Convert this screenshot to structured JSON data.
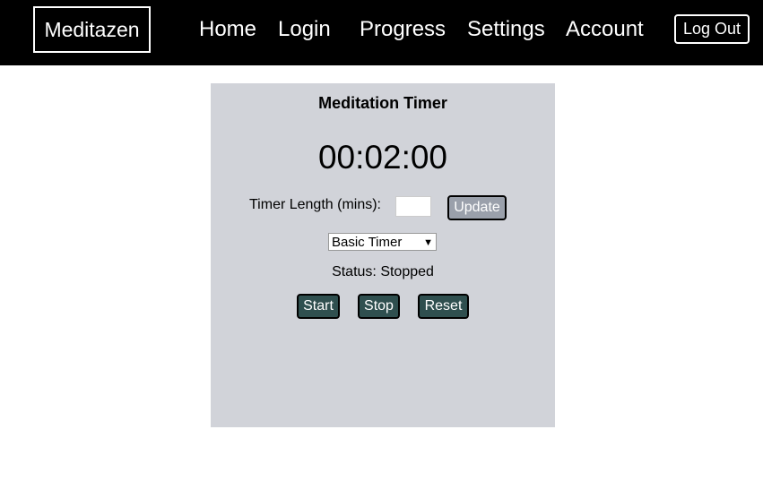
{
  "nav": {
    "brand": "Meditazen",
    "links": [
      "Home",
      "Login",
      "Progress",
      "Settings",
      "Account"
    ],
    "logout_label": "Log Out"
  },
  "timer": {
    "title": "Meditation Timer",
    "display": "00:02:00",
    "length_label": "Timer Length (mins):",
    "length_value": "",
    "update_label": "Update",
    "mode_selected": "Basic Timer",
    "status": "Status: Stopped",
    "buttons": {
      "start": "Start",
      "stop": "Stop",
      "reset": "Reset"
    }
  },
  "colors": {
    "navbar_bg": "#000000",
    "panel_bg": "#d1d3d9",
    "control_button_bg": "#2f4f4f",
    "update_button_bg": "#9aa0ab"
  }
}
